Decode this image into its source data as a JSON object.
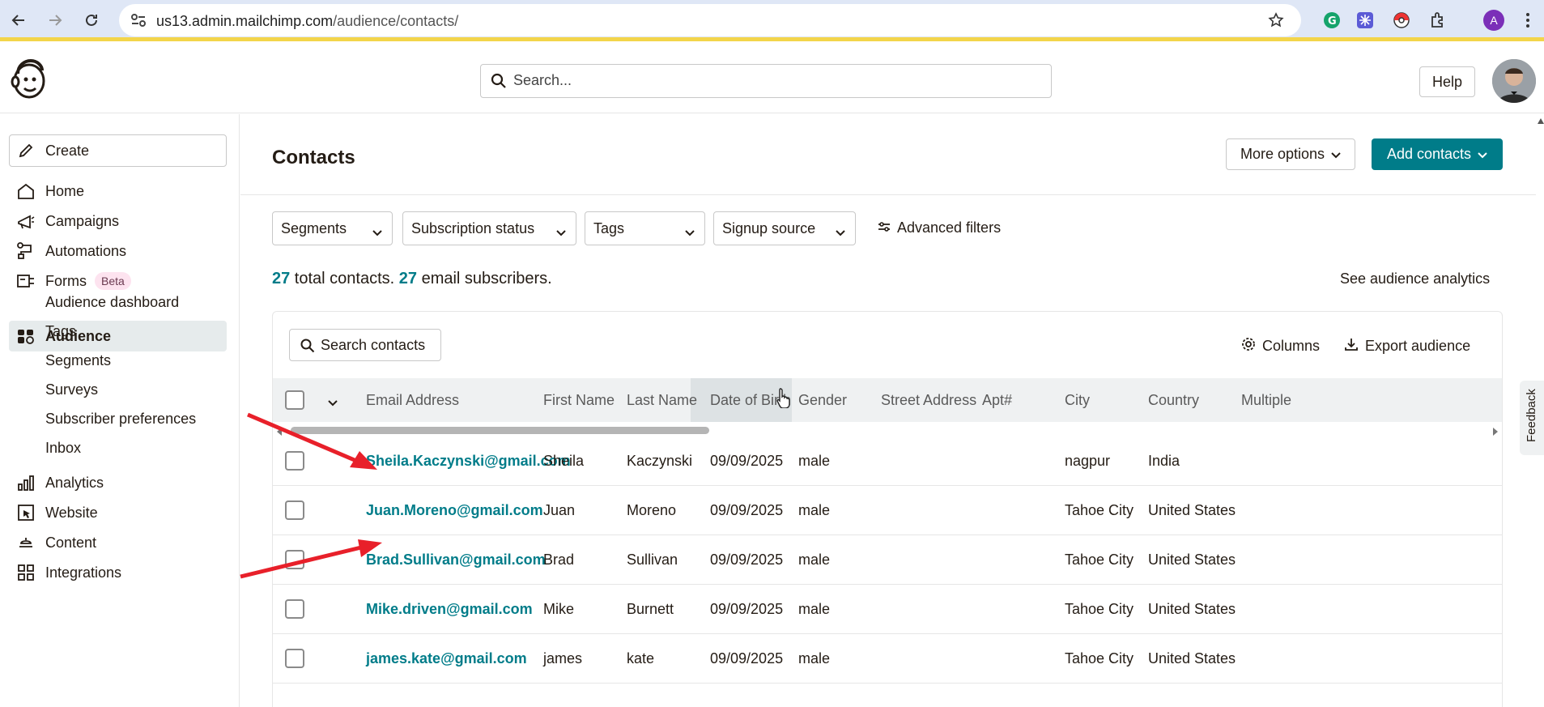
{
  "browser": {
    "url_host": "us13.admin.mailchimp.com",
    "url_path": "/audience/contacts/",
    "profile_initial": "A"
  },
  "header": {
    "search_placeholder": "Search...",
    "help_label": "Help"
  },
  "sidebar": {
    "create_label": "Create",
    "items": [
      {
        "label": "Home",
        "icon": "home-icon"
      },
      {
        "label": "Campaigns",
        "icon": "megaphone-icon"
      },
      {
        "label": "Automations",
        "icon": "automation-icon"
      },
      {
        "label": "Forms",
        "icon": "form-icon",
        "badge": "Beta"
      },
      {
        "label": "Audience",
        "icon": "audience-icon",
        "active": true
      },
      {
        "label": "Analytics",
        "icon": "bar-chart-icon"
      },
      {
        "label": "Website",
        "icon": "website-icon"
      },
      {
        "label": "Content",
        "icon": "content-icon"
      },
      {
        "label": "Integrations",
        "icon": "grid-icon"
      }
    ],
    "audience_subitems": [
      "Audience dashboard",
      "Tags",
      "Segments",
      "Surveys",
      "Subscriber preferences",
      "Inbox"
    ]
  },
  "main": {
    "title": "Contacts",
    "more_options_label": "More options",
    "add_contacts_label": "Add contacts",
    "filters": [
      "Segments",
      "Subscription status",
      "Tags",
      "Signup source"
    ],
    "advanced_filters_label": "Advanced filters",
    "totals": {
      "total": "27",
      "total_text": " total contacts. ",
      "subscribers": "27",
      "subscribers_text": " email subscribers."
    },
    "analytics_link": "See audience analytics",
    "search_contacts_label": "Search contacts",
    "columns_label": "Columns",
    "export_label": "Export audience",
    "columns": [
      "Email Address",
      "First Name",
      "Last Name",
      "Date of Birth",
      "Gender",
      "Street Address",
      "Apt#",
      "City",
      "Country",
      "Multiple"
    ],
    "rows": [
      {
        "email": "Sheila.Kaczynski@gmail.com",
        "first": "Sheila",
        "last": "Kaczynski",
        "dob": "09/09/2025",
        "gender": "male",
        "city": "nagpur",
        "country": "India"
      },
      {
        "email": "Juan.Moreno@gmail.com",
        "first": "Juan",
        "last": "Moreno",
        "dob": "09/09/2025",
        "gender": "male",
        "city": "Tahoe City",
        "country": "United States"
      },
      {
        "email": "Brad.Sullivan@gmail.com",
        "first": "Brad",
        "last": "Sullivan",
        "dob": "09/09/2025",
        "gender": "male",
        "city": "Tahoe City",
        "country": "United States"
      },
      {
        "email": "Mike.driven@gmail.com",
        "first": "Mike",
        "last": "Burnett",
        "dob": "09/09/2025",
        "gender": "male",
        "city": "Tahoe City",
        "country": "United States"
      },
      {
        "email": "james.kate@gmail.com",
        "first": "james",
        "last": "kate",
        "dob": "09/09/2025",
        "gender": "male",
        "city": "Tahoe City",
        "country": "United States"
      }
    ]
  },
  "feedback_label": "Feedback",
  "colors": {
    "accent": "#007c89",
    "annotation": "#e8202a"
  }
}
